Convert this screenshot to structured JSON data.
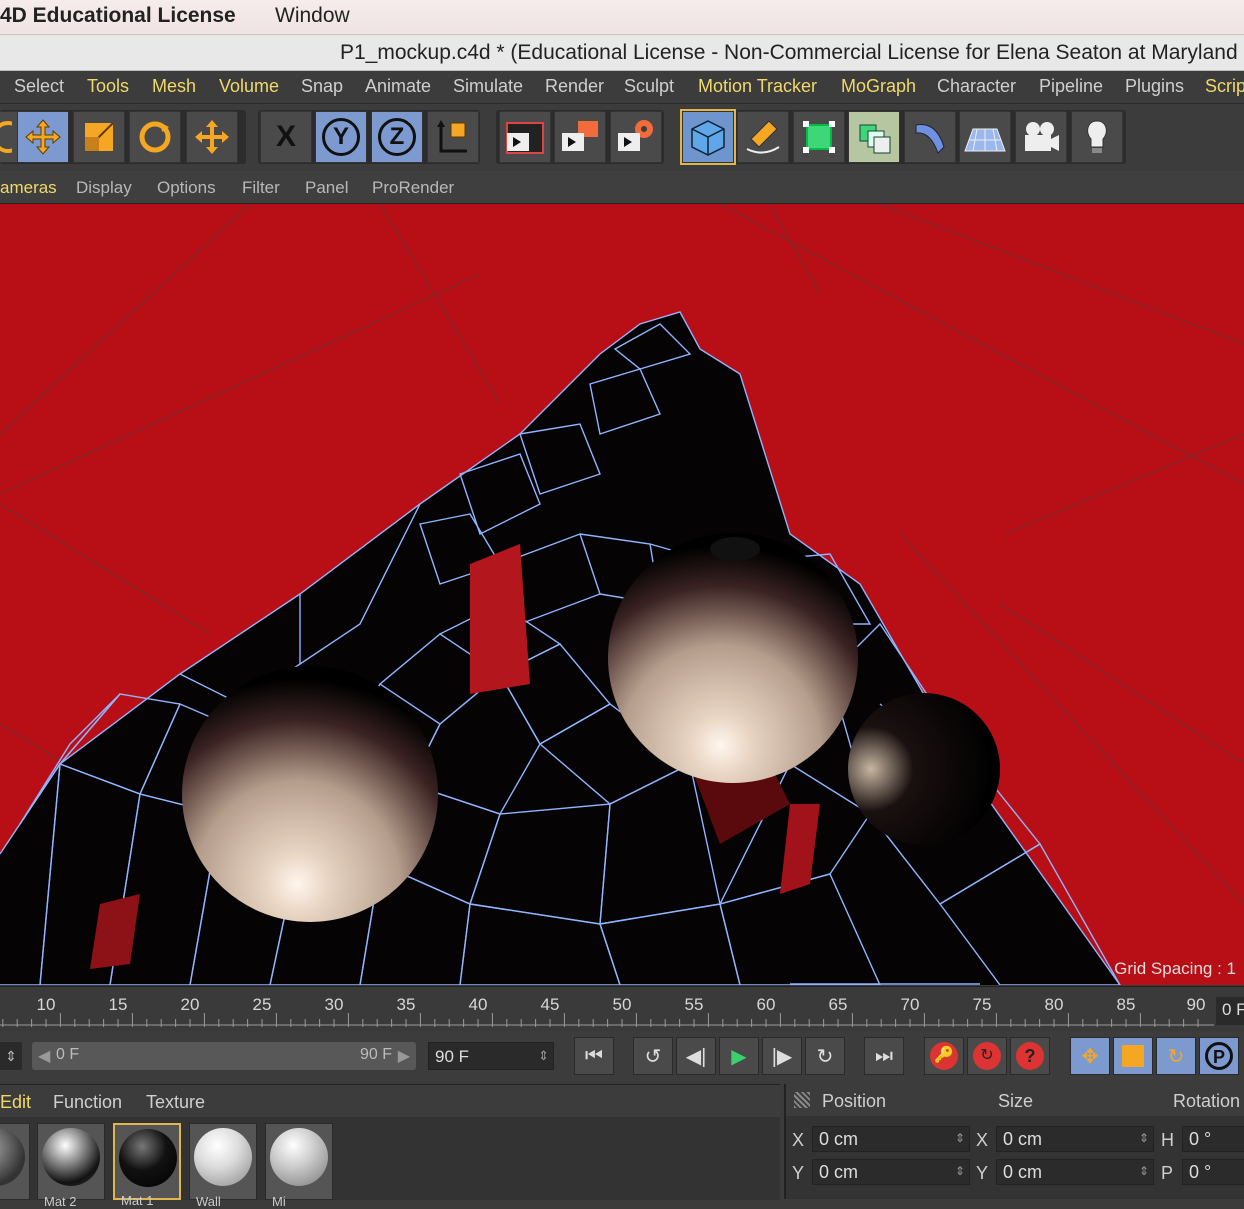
{
  "mac_menubar": {
    "app_name": "4D Educational License",
    "window_menu": "Window"
  },
  "window": {
    "title": "P1_mockup.c4d * (Educational License - Non-Commercial License for Elena Seaton at Maryland I"
  },
  "menu": [
    {
      "label": "Select",
      "highlight": false
    },
    {
      "label": "Tools",
      "highlight": true
    },
    {
      "label": "Mesh",
      "highlight": true
    },
    {
      "label": "Volume",
      "highlight": true
    },
    {
      "label": "Snap",
      "highlight": false
    },
    {
      "label": "Animate",
      "highlight": false
    },
    {
      "label": "Simulate",
      "highlight": false
    },
    {
      "label": "Render",
      "highlight": false
    },
    {
      "label": "Sculpt",
      "highlight": false
    },
    {
      "label": "Motion Tracker",
      "highlight": true
    },
    {
      "label": "MoGraph",
      "highlight": true
    },
    {
      "label": "Character",
      "highlight": false
    },
    {
      "label": "Pipeline",
      "highlight": false
    },
    {
      "label": "Plugins",
      "highlight": false
    },
    {
      "label": "Scrip",
      "highlight": true
    }
  ],
  "toolbar": {
    "x_label": "X",
    "y_label": "Y",
    "z_label": "Z"
  },
  "viewport_menu": [
    {
      "label": "ameras",
      "highlight": true
    },
    {
      "label": "Display",
      "highlight": false
    },
    {
      "label": "Options",
      "highlight": false
    },
    {
      "label": "Filter",
      "highlight": false
    },
    {
      "label": "Panel",
      "highlight": false
    },
    {
      "label": "ProRender",
      "highlight": false
    }
  ],
  "viewport": {
    "grid_spacing_label": "Grid Spacing : 1"
  },
  "timeline": {
    "ticks": [
      "10",
      "15",
      "20",
      "25",
      "30",
      "35",
      "40",
      "45",
      "50",
      "55",
      "60",
      "65",
      "70",
      "75",
      "80",
      "85",
      "90"
    ],
    "end_field": "0 F"
  },
  "transport": {
    "range_start": "0 F",
    "range_end": "90 F",
    "max_frame": "90 F"
  },
  "materials": {
    "menu": [
      {
        "label": "Edit",
        "highlight": true
      },
      {
        "label": "Function",
        "highlight": false
      },
      {
        "label": "Texture",
        "highlight": false
      }
    ],
    "items": [
      {
        "name": "Mat 2",
        "kind": "chrome"
      },
      {
        "name": "Mat 1",
        "kind": "black"
      },
      {
        "name": "Wall",
        "kind": "white"
      },
      {
        "name": "Mi",
        "kind": "silver"
      }
    ]
  },
  "coordinates": {
    "headers": {
      "position": "Position",
      "size": "Size",
      "rotation": "Rotation"
    },
    "rows": [
      {
        "axis": "X",
        "position": "0 cm",
        "size_axis": "X",
        "size": "0 cm",
        "rot_axis": "H",
        "rotation": "0 °"
      },
      {
        "axis": "Y",
        "position": "0 cm",
        "size_axis": "Y",
        "size": "0 cm",
        "rot_axis": "P",
        "rotation": "0 °"
      }
    ]
  },
  "colors": {
    "viewport_bg": "#b80f16",
    "accent": "#f0d96a",
    "wire": "#8fb4ff"
  }
}
